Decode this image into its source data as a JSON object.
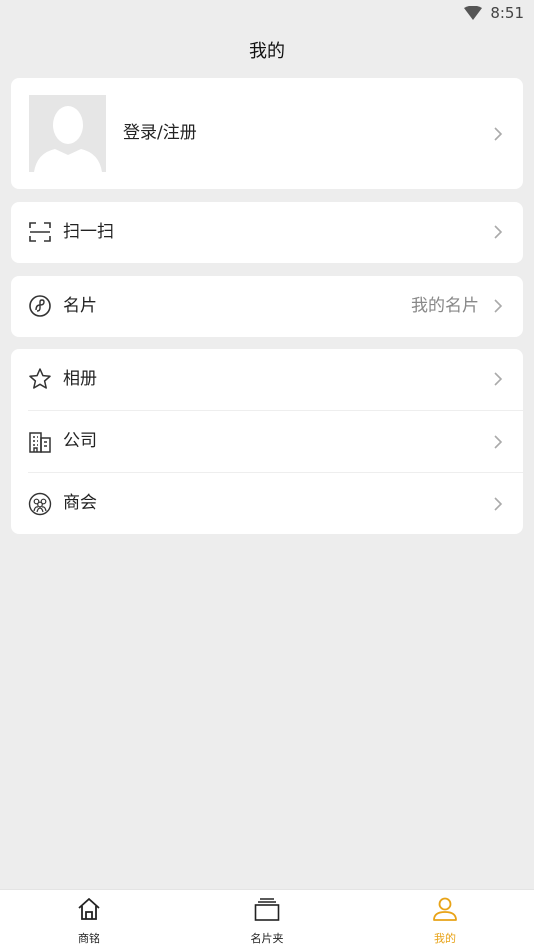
{
  "status_bar": {
    "time": "8:51",
    "icons": [
      "wifi-icon"
    ]
  },
  "header": {
    "title": "我的"
  },
  "profile": {
    "login_label": "登录/注册",
    "icon": "avatar-placeholder"
  },
  "scan": {
    "label": "扫一扫",
    "icon": "scan-icon"
  },
  "card": {
    "label": "名片",
    "right_text": "我的名片",
    "icon": "card-link-icon"
  },
  "menu": {
    "items": [
      {
        "label": "相册",
        "icon": "star-icon"
      },
      {
        "label": "公司",
        "icon": "building-icon"
      },
      {
        "label": "商会",
        "icon": "group-icon"
      }
    ]
  },
  "tabbar": {
    "tabs": [
      {
        "label": "商铭",
        "icon": "home-icon"
      },
      {
        "label": "名片夹",
        "icon": "cards-icon"
      },
      {
        "label": "我的",
        "icon": "person-icon",
        "active": true
      }
    ],
    "active_color": "#e8a317"
  }
}
